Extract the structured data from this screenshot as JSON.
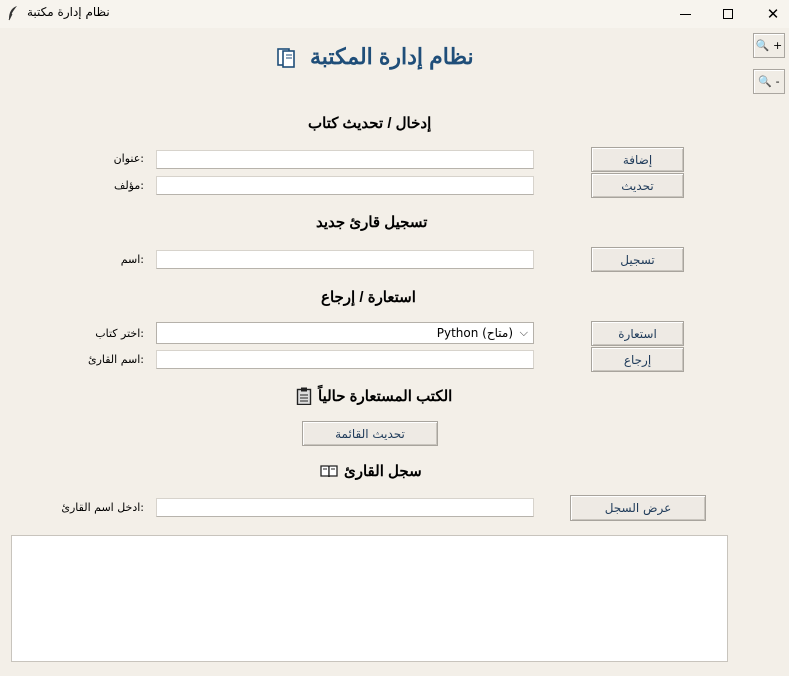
{
  "window": {
    "title": "نظام إدارة مكتبة",
    "minimize": "—",
    "maximize": "☐",
    "close": "✕"
  },
  "header": {
    "title": "نظام إدارة المكتبة",
    "title_icon": "📚"
  },
  "zoom": {
    "in_label": "🔍 +",
    "out_label": "🔍 -"
  },
  "book_section": {
    "heading": "إدخال / تحديث كتاب",
    "title_label": ":عنوان",
    "author_label": ":مؤلف",
    "title_value": "",
    "author_value": "",
    "add_button": "إضافة",
    "update_button": "تحديث"
  },
  "reader_section": {
    "heading": "تسجيل قارئ جديد",
    "name_label": ":اسم",
    "name_value": "",
    "register_button": "تسجيل"
  },
  "borrow_section": {
    "heading": "استعارة / إرجاع",
    "book_label": ":اختر كتاب",
    "book_selected": "Python (متاح)",
    "reader_label": ":اسم القارئ",
    "reader_value": "",
    "borrow_button": "استعارة",
    "return_button": "إرجاع"
  },
  "borrowed_section": {
    "heading": "الكتب المستعارة حالياً",
    "icon": "📋",
    "refresh_button": "تحديث القائمة"
  },
  "history_section": {
    "heading": "سجل القارئ",
    "icon": "📖",
    "reader_label": ":ادخل اسم القارئ",
    "reader_value": "",
    "show_button": "عرض السجل"
  },
  "output": {
    "text": ""
  },
  "colors": {
    "heading_blue": "#1f4e79",
    "background": "#f3efe8"
  }
}
